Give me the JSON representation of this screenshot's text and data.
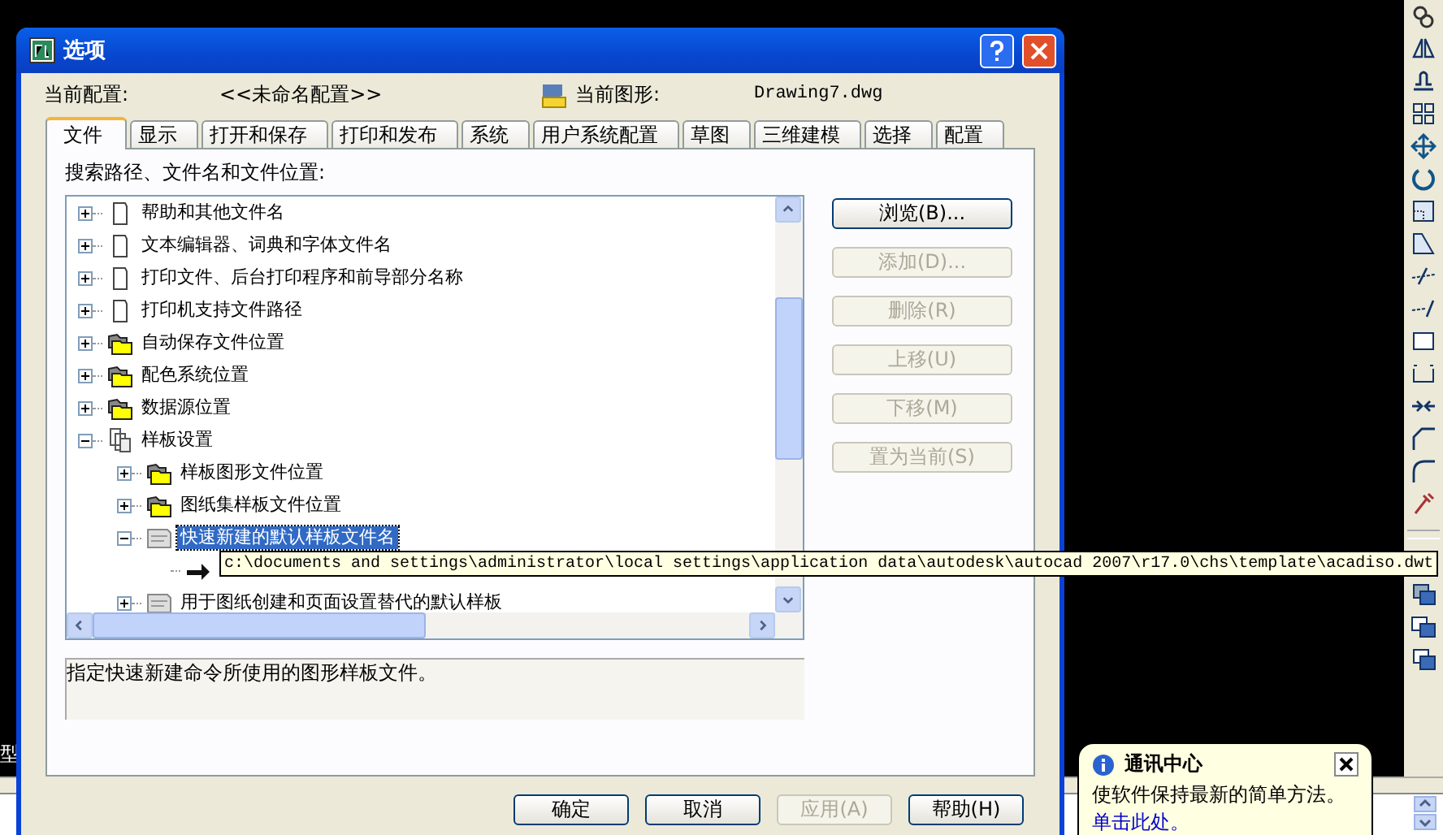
{
  "window": {
    "title": "选项"
  },
  "header": {
    "profile_label": "当前配置:",
    "profile_value": "<<未命名配置>>",
    "drawing_label": "当前图形:",
    "drawing_value": "Drawing7.dwg"
  },
  "tabs": [
    {
      "label": "文件",
      "selected": true
    },
    {
      "label": "显示",
      "selected": false
    },
    {
      "label": "打开和保存",
      "selected": false
    },
    {
      "label": "打印和发布",
      "selected": false
    },
    {
      "label": "系统",
      "selected": false
    },
    {
      "label": "用户系统配置",
      "selected": false
    },
    {
      "label": "草图",
      "selected": false
    },
    {
      "label": "三维建模",
      "selected": false
    },
    {
      "label": "选择",
      "selected": false
    },
    {
      "label": "配置",
      "selected": false
    }
  ],
  "tree_label": "搜索路径、文件名和文件位置:",
  "tree": [
    {
      "label": "帮助和其他文件名",
      "kind": "file",
      "expanded": false,
      "selected": false
    },
    {
      "label": "文本编辑器、词典和字体文件名",
      "kind": "file",
      "expanded": false,
      "selected": false
    },
    {
      "label": "打印文件、后台打印程序和前导部分名称",
      "kind": "file",
      "expanded": false,
      "selected": false
    },
    {
      "label": "打印机支持文件路径",
      "kind": "file",
      "expanded": false,
      "selected": false
    },
    {
      "label": "自动保存文件位置",
      "kind": "folder",
      "expanded": false,
      "selected": false
    },
    {
      "label": "配色系统位置",
      "kind": "folder",
      "expanded": false,
      "selected": false
    },
    {
      "label": "数据源位置",
      "kind": "folder",
      "expanded": false,
      "selected": false
    },
    {
      "label": "样板设置",
      "kind": "template-group",
      "expanded": true,
      "selected": false,
      "children": [
        {
          "label": "样板图形文件位置",
          "kind": "folder",
          "expanded": false,
          "selected": false
        },
        {
          "label": "图纸集样板文件位置",
          "kind": "folder",
          "expanded": false,
          "selected": false
        },
        {
          "label": "快速新建的默认样板文件名",
          "kind": "dwt",
          "expanded": true,
          "selected": true,
          "children": [
            {
              "kind": "path"
            }
          ]
        },
        {
          "label": "用于图纸创建和页面设置替代的默认样板",
          "kind": "dwt",
          "expanded": false,
          "selected": false
        }
      ]
    }
  ],
  "side_buttons": [
    {
      "label": "浏览(B)...",
      "disabled": false
    },
    {
      "label": "添加(D)...",
      "disabled": true
    },
    {
      "label": "删除(R)",
      "disabled": true
    },
    {
      "label": "上移(U)",
      "disabled": true
    },
    {
      "label": "下移(M)",
      "disabled": true
    },
    {
      "label": "置为当前(S)",
      "disabled": true
    }
  ],
  "description": "指定快速新建命令所使用的图形样板文件。",
  "dialog_buttons": [
    {
      "label": "确定",
      "disabled": false
    },
    {
      "label": "取消",
      "disabled": false
    },
    {
      "label": "应用(A)",
      "disabled": true
    },
    {
      "label": "帮助(H)",
      "disabled": false
    }
  ],
  "tooltip": "c:\\documents and settings\\administrator\\local settings\\application data\\autodesk\\autocad 2007\\r17.0\\chs\\template\\acadiso.dwt",
  "background_text": "型",
  "notification": {
    "title": "通讯中心",
    "message": "使软件保持最新的简单方法。",
    "link": "单击此处。"
  }
}
